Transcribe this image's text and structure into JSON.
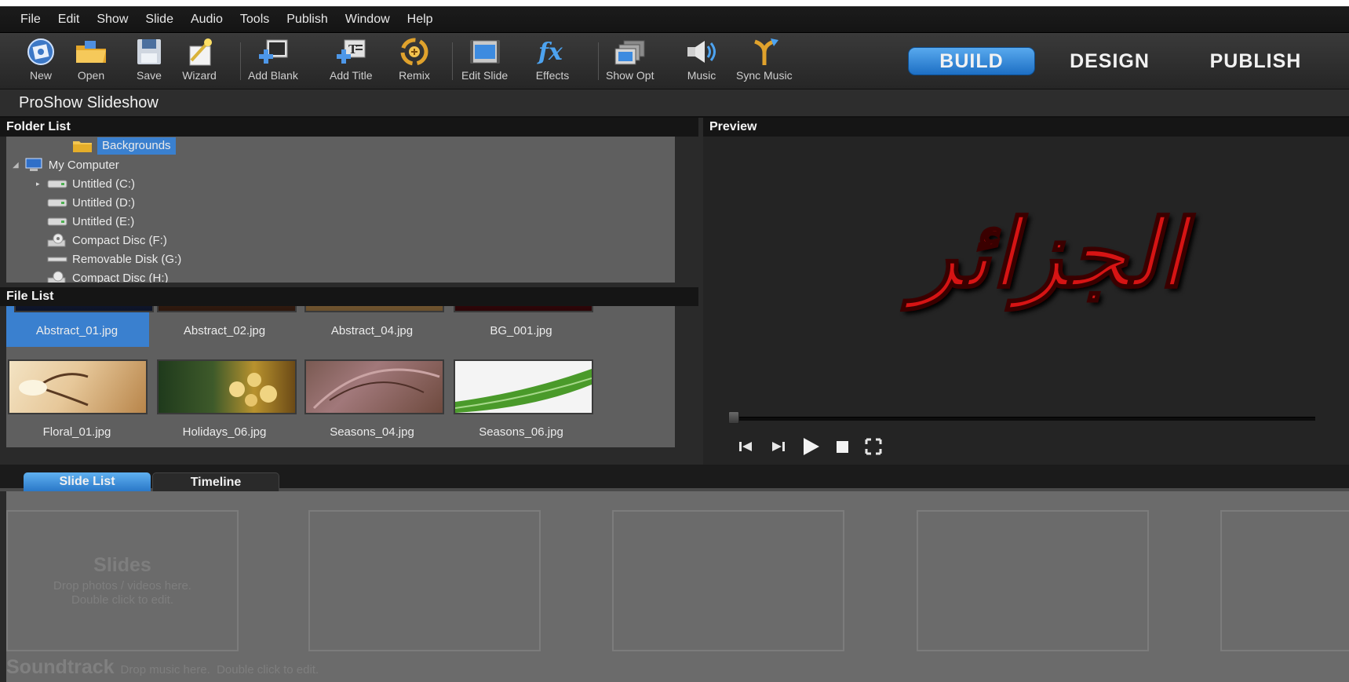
{
  "menu": [
    "File",
    "Edit",
    "Show",
    "Slide",
    "Audio",
    "Tools",
    "Publish",
    "Window",
    "Help"
  ],
  "toolbar": {
    "new": "New",
    "open": "Open",
    "save": "Save",
    "wizard": "Wizard",
    "add_blank": "Add Blank",
    "add_title": "Add Title",
    "remix": "Remix",
    "edit_slide": "Edit Slide",
    "effects": "Effects",
    "show_opt": "Show Opt",
    "music": "Music",
    "sync_music": "Sync Music"
  },
  "mode_tabs": {
    "build": "BUILD",
    "design": "DESIGN",
    "publish": "PUBLISH",
    "active": "BUILD"
  },
  "title": "ProShow Slideshow",
  "folder_list": {
    "header": "Folder List",
    "items": [
      {
        "label": "Backgrounds",
        "icon": "folder-icon",
        "selected": true
      },
      {
        "label": "My Computer",
        "icon": "computer-icon"
      },
      {
        "label": "Untitled (C:)",
        "icon": "drive-icon"
      },
      {
        "label": "Untitled (D:)",
        "icon": "drive-icon"
      },
      {
        "label": "Untitled (E:)",
        "icon": "drive-icon"
      },
      {
        "label": "Compact Disc (F:)",
        "icon": "cd-drive-icon"
      },
      {
        "label": "Removable Disk (G:)",
        "icon": "removable-disk-icon"
      },
      {
        "label": "Compact Disc (H:)",
        "icon": "cd-drive-icon"
      }
    ]
  },
  "file_list": {
    "header": "File List",
    "files": [
      {
        "name": "Abstract_01.jpg",
        "selected": true
      },
      {
        "name": "Abstract_02.jpg"
      },
      {
        "name": "Abstract_04.jpg"
      },
      {
        "name": "BG_001.jpg"
      },
      {
        "name": "Floral_01.jpg"
      },
      {
        "name": "Holidays_06.jpg"
      },
      {
        "name": "Seasons_04.jpg"
      },
      {
        "name": "Seasons_06.jpg"
      }
    ]
  },
  "preview": {
    "header": "Preview",
    "artwork_text": "الجزائر",
    "progress": 0
  },
  "bottom_tabs": {
    "slide_list": "Slide List",
    "timeline": "Timeline",
    "active": "Slide List"
  },
  "slides": {
    "title": "Slides",
    "hint1": "Drop photos / videos here.",
    "hint2": "Double click to edit."
  },
  "soundtrack": {
    "title": "Soundtrack",
    "hint": "Drop music here.  Double click to edit."
  },
  "colors": {
    "accent": "#2f86d9",
    "selection": "#3a80cf",
    "artwork_red": "#d61414"
  }
}
